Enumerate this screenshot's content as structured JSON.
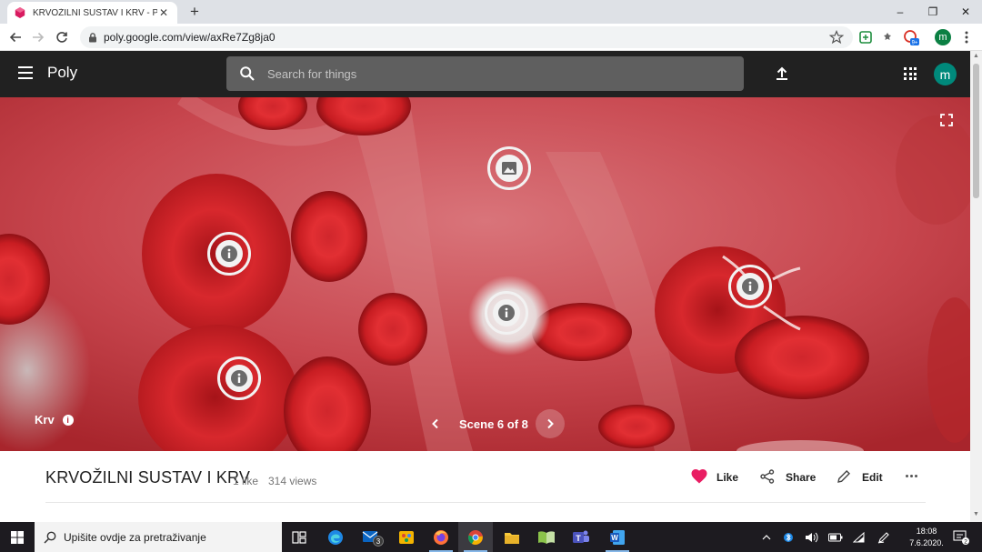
{
  "browser": {
    "tab_title": "KRVOŽILNI SUSTAV I KRV - Poly",
    "tab_close": "✕",
    "new_tab": "+",
    "url": "poly.google.com/view/axRe7Zg8ja0",
    "profile_initial": "m",
    "extension_badge": "9+",
    "window_controls": {
      "minimize": "–",
      "restore": "❐",
      "close": "✕"
    }
  },
  "header": {
    "brand": "Poly",
    "search_placeholder": "Search for things",
    "avatar_initial": "m"
  },
  "viewer": {
    "credit_label": "Krv",
    "credit_info": "i",
    "scene_label": "Scene 6 of 8",
    "hotspots": [
      {
        "kind": "image-icon"
      },
      {
        "kind": "info-icon"
      },
      {
        "kind": "info-icon"
      },
      {
        "kind": "info-icon"
      },
      {
        "kind": "info-icon"
      }
    ]
  },
  "model": {
    "title": "KRVOŽILNI SUSTAV I KRV",
    "likes": "1 like",
    "views": "314 views",
    "like_label": "Like",
    "share_label": "Share",
    "edit_label": "Edit"
  },
  "taskbar": {
    "search_placeholder": "Upišite ovdje za pretraživanje",
    "mail_badge": "3",
    "time": "18:08",
    "date": "7.6.2020.",
    "notification_count": "2",
    "accent": "#86b7e8"
  },
  "colors": {
    "poly_header_bg": "#212121",
    "like_heart": "#e91e63",
    "avatar_teal": "#00897b",
    "blood_red": "#c8454d"
  }
}
